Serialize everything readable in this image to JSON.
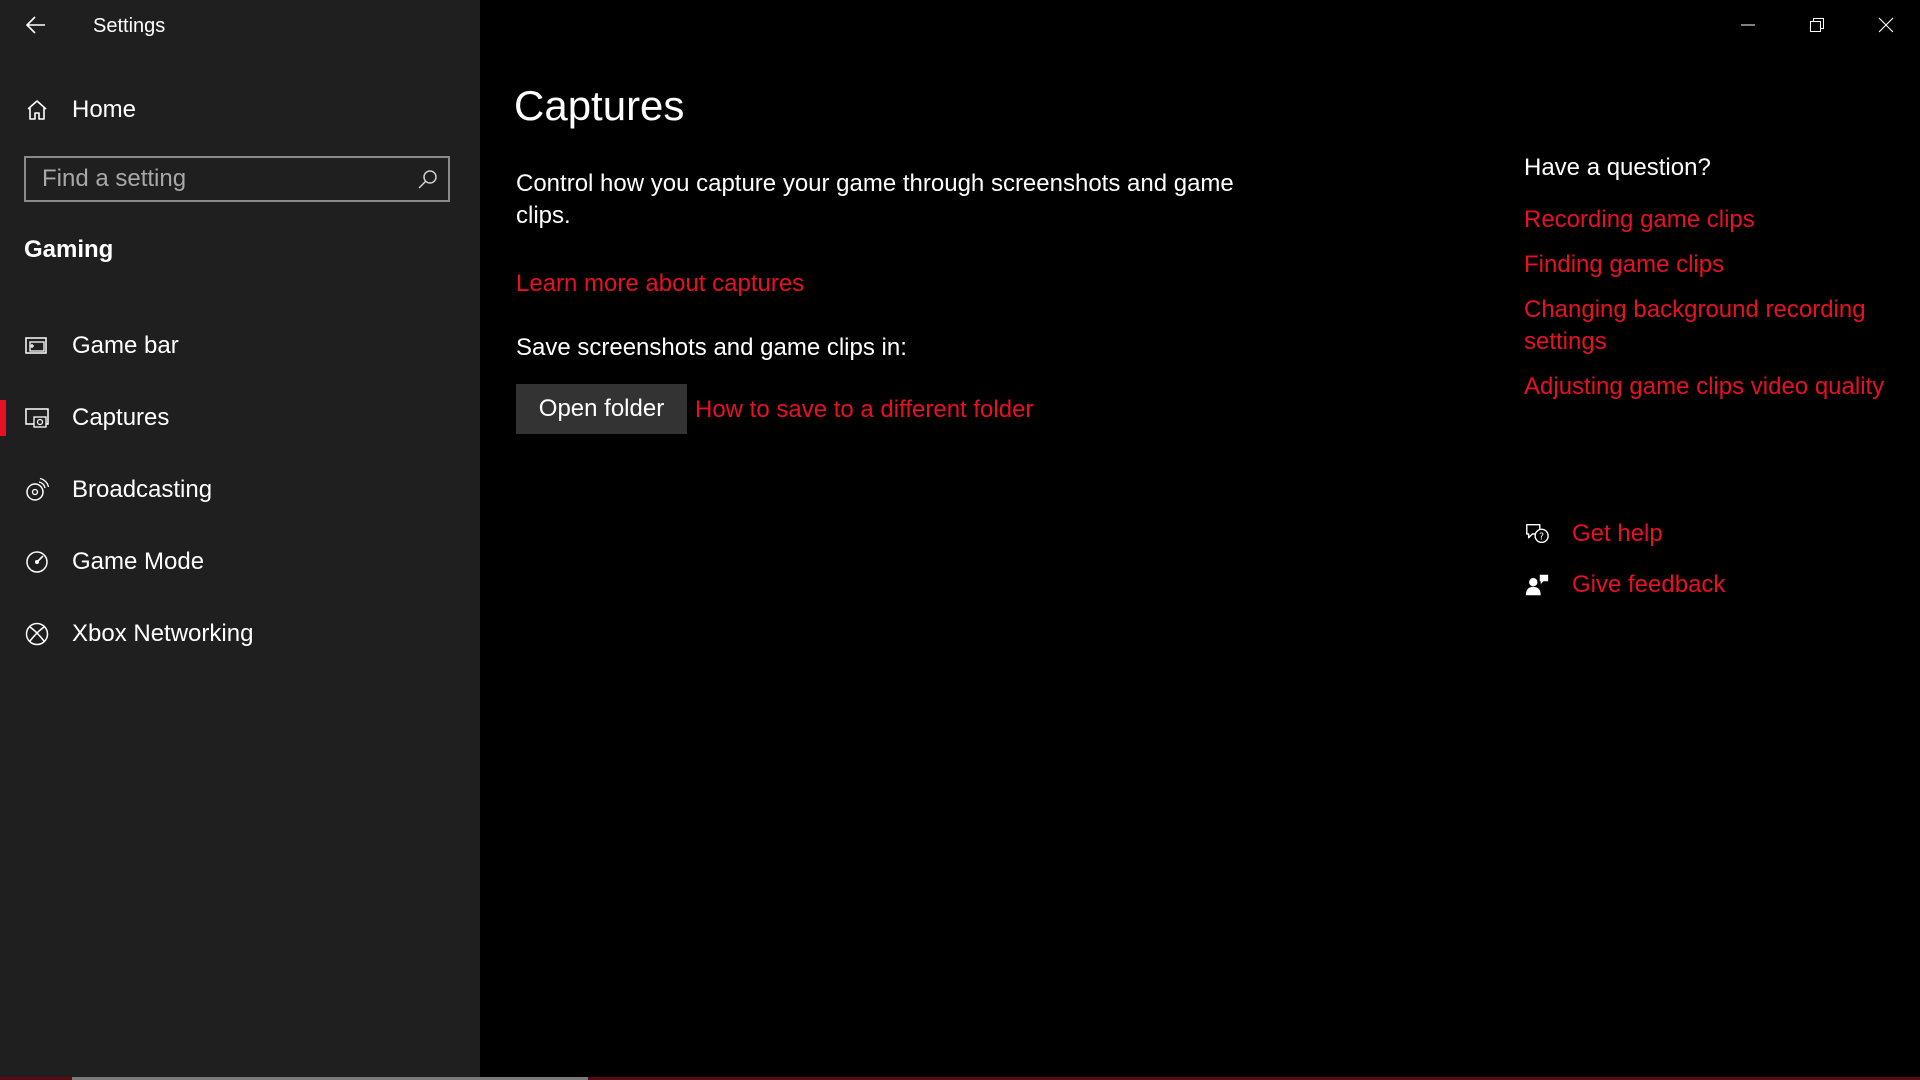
{
  "window": {
    "title": "Settings",
    "controls": [
      "minimize",
      "restore",
      "close"
    ]
  },
  "sidebar": {
    "home_label": "Home",
    "search_placeholder": "Find a setting",
    "section_title": "Gaming",
    "items": [
      {
        "label": "Game bar",
        "icon": "game-bar-icon",
        "selected": false
      },
      {
        "label": "Captures",
        "icon": "captures-icon",
        "selected": true
      },
      {
        "label": "Broadcasting",
        "icon": "broadcasting-icon",
        "selected": false
      },
      {
        "label": "Game Mode",
        "icon": "game-mode-icon",
        "selected": false
      },
      {
        "label": "Xbox Networking",
        "icon": "xbox-icon",
        "selected": false
      }
    ]
  },
  "main": {
    "title": "Captures",
    "description": "Control how you capture your game through screenshots and game clips.",
    "learn_link": "Learn more about captures",
    "save_label": "Save screenshots and game clips in:",
    "open_folder_button": "Open folder",
    "how_to_link": "How to save to a different folder"
  },
  "help": {
    "heading": "Have a question?",
    "links": [
      "Recording game clips",
      "Finding game clips",
      "Changing background recording settings",
      "Adjusting game clips video quality"
    ],
    "get_help": "Get help",
    "give_feedback": "Give feedback"
  },
  "colors": {
    "accent": "#e81123",
    "sidebar_bg": "#1f1f1f",
    "main_bg": "#000000"
  }
}
